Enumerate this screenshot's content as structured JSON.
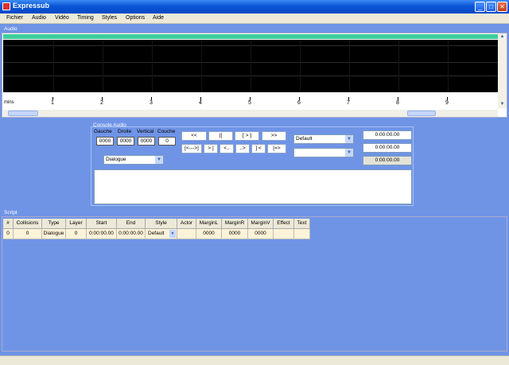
{
  "window": {
    "title": "Expressub",
    "minimize_glyph": "_",
    "maximize_glyph": "□",
    "close_glyph": "✕"
  },
  "menu": [
    "Fichier",
    "Audio",
    "Vidéo",
    "Timing",
    "Styles",
    "Options",
    "Aide"
  ],
  "audio": {
    "label": "Audio",
    "ruler_unit": "mins",
    "ticks": [
      "1",
      "2",
      "3",
      "4",
      "5",
      "6",
      "7",
      "8",
      "9"
    ]
  },
  "console": {
    "label": "Console Audio",
    "fields": [
      {
        "label": "Gauche",
        "value": "0000"
      },
      {
        "label": "Droite",
        "value": "0000"
      },
      {
        "label": "Vertical",
        "value": "0000"
      },
      {
        "label": "Couche",
        "value": "0"
      }
    ],
    "buttons_row1": [
      "<<",
      "|[",
      "[ > ]",
      ">>"
    ],
    "buttons_row2": [
      "[<--->]",
      "> ]",
      "<..",
      "..>",
      "] <",
      "[=>"
    ],
    "type_select": "Dialogue",
    "style_select": "Default",
    "actor_select": "",
    "times": [
      "0:00:00.00",
      "0:00:00.00",
      "0:00:00.00"
    ]
  },
  "script": {
    "label": "Script",
    "columns": [
      "#",
      "Collisions",
      "Type",
      "Layer",
      "Start",
      "End",
      "Style",
      "Actor",
      "MarginL",
      "MarginR",
      "MarginV",
      "Effect",
      "Text"
    ],
    "rows": [
      [
        "0",
        "0",
        "Dialogue",
        "0",
        "0:00:00.00",
        "0:00:00.00",
        "Default",
        "",
        "0000",
        "0000",
        "0000",
        "",
        ""
      ]
    ]
  },
  "colors": {
    "background": "#6f94e6",
    "titlebar": "#0a55d6",
    "waveform": "#000000",
    "wave_top": "#3ecf9a"
  }
}
